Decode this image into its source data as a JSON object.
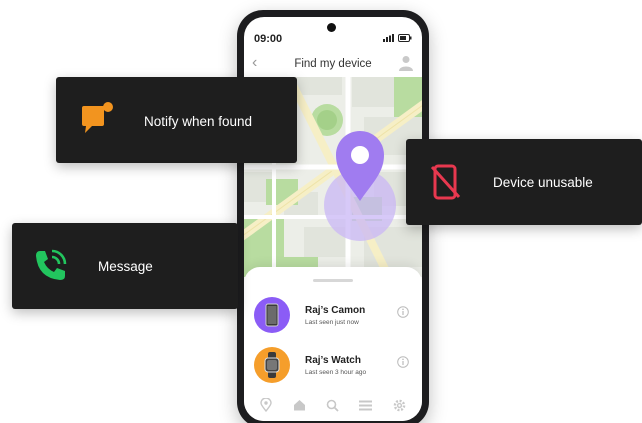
{
  "status_bar": {
    "time": "09:00"
  },
  "header": {
    "title": "Find my device"
  },
  "devices": [
    {
      "name": "Raj’s Camon",
      "last_seen": "Last seen just now",
      "avatar_color": "#8b5cf6"
    },
    {
      "name": "Raj’s Watch",
      "last_seen": "Last seen 3 hour ago",
      "avatar_color": "#f59e2b"
    }
  ],
  "bottom_nav": [
    "location-pin-icon",
    "home-icon",
    "search-icon",
    "menu-icon",
    "settings-icon"
  ],
  "cards": {
    "notify": {
      "label": "Notify when found",
      "icon": "notification-icon",
      "icon_color": "#f2941f"
    },
    "unusable": {
      "label": "Device unusable",
      "icon": "phone-off-icon",
      "icon_color": "#e8384f"
    },
    "message": {
      "label": "Message",
      "icon": "phone-call-icon",
      "icon_color": "#22c55e"
    }
  },
  "colors": {
    "pin": "#a07cf0",
    "card_bg": "#1e1e1e",
    "map_green": "#b8dca0",
    "map_road": "#f6efc6"
  }
}
